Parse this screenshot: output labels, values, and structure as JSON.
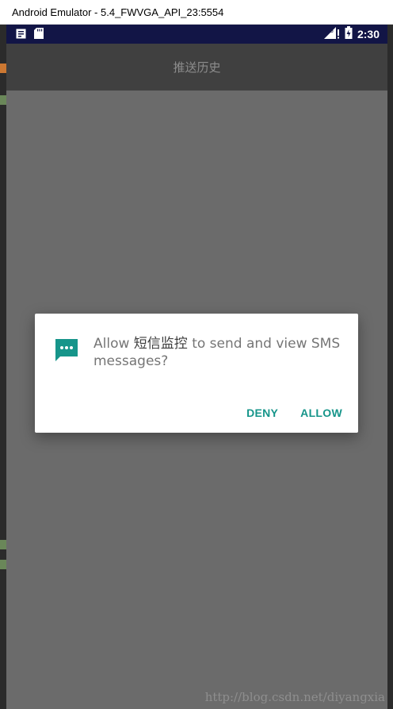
{
  "window": {
    "title": "Android Emulator - 5.4_FWVGA_API_23:5554"
  },
  "status_bar": {
    "time": "2:30",
    "network": "4G",
    "icons_left": [
      "notification-card-icon",
      "sd-card-icon"
    ],
    "icons_right": [
      "signal-4g-icon",
      "battery-icon"
    ]
  },
  "app_bar": {
    "title": "推送历史"
  },
  "dialog": {
    "icon": "sms-message-icon",
    "message_prefix": "Allow ",
    "app_name": "短信监控",
    "message_suffix": " to send and view SMS messages?",
    "deny_label": "DENY",
    "allow_label": "ALLOW"
  },
  "watermark": "http://blog.csdn.net/diyangxia",
  "colors": {
    "status_bar": "#121546",
    "app_bar": "#404040",
    "scrim": "#6b6b6b",
    "accent": "#16958a",
    "dialog_bg": "#ffffff"
  }
}
